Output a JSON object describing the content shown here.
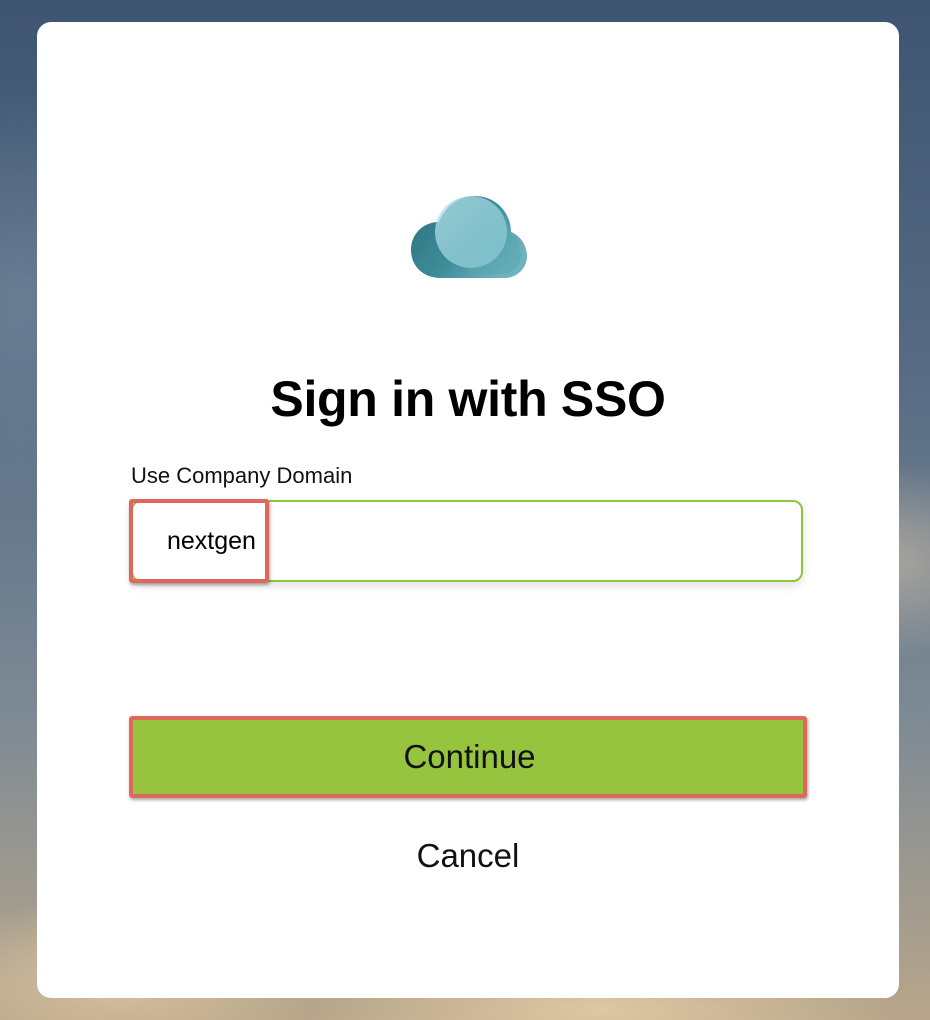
{
  "dialog": {
    "title": "Sign in with SSO",
    "logo_icon": "cloud-logo-icon",
    "domain_field": {
      "label": "Use Company Domain",
      "value": "nextgen",
      "placeholder": ""
    },
    "continue_label": "Continue",
    "cancel_label": "Cancel"
  },
  "colors": {
    "accent_green": "#97c43f",
    "input_border": "#8cc63f",
    "highlight_red": "#e0685a",
    "logo_dark": "#2f7a86",
    "logo_light": "#a8dbe4"
  }
}
